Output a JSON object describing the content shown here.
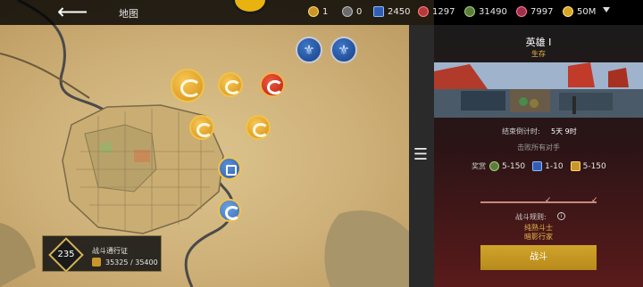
{
  "header": {
    "title": "地图",
    "resources": [
      {
        "icon": "gold-token-icon",
        "value": "1"
      },
      {
        "icon": "silver-token-icon",
        "value": "0"
      },
      {
        "icon": "blue-card-icon",
        "value": "2450"
      },
      {
        "icon": "red-orb-icon",
        "value": "1297"
      },
      {
        "icon": "green-gear-icon",
        "value": "31490"
      },
      {
        "icon": "crimson-gem-icon",
        "value": "7997"
      },
      {
        "icon": "coin-icon",
        "value": "50M"
      }
    ]
  },
  "battle_pass": {
    "level": "235",
    "title": "战斗通行证",
    "progress": "35325 / 35400"
  },
  "panel": {
    "title": "英雄 I",
    "subtitle": "生存",
    "countdown_label": "结束倒计时:",
    "countdown_value": "5天 9时",
    "defeat_text": "击败所有对手",
    "rewards_label": "奖赏",
    "rewards": [
      {
        "icon": "gear-reward-icon",
        "value": "5-150"
      },
      {
        "icon": "card-reward-icon",
        "value": "1-10"
      },
      {
        "icon": "rank-reward-icon",
        "value": "5-150"
      }
    ],
    "rules_label": "战斗规则:",
    "rules": [
      "纯熟斗士",
      "暗影行家"
    ],
    "fight_button": "战斗"
  },
  "colors": {
    "accent_gold": "#d0a42a",
    "panel_red": "#5a1a1a",
    "subtitle_gold": "#e7b64a"
  }
}
